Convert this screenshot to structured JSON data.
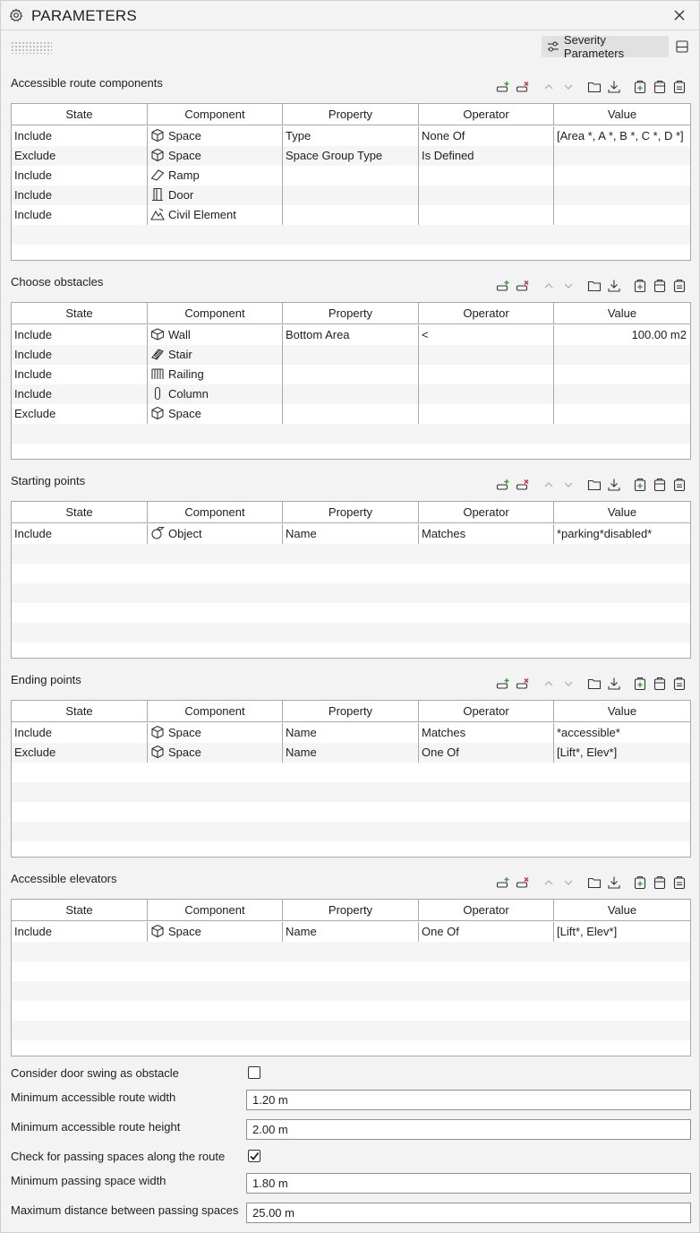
{
  "window": {
    "title": "PARAMETERS"
  },
  "toolbar": {
    "severity_label": "Severity Parameters"
  },
  "columns": [
    "State",
    "Component",
    "Property",
    "Operator",
    "Value"
  ],
  "sections": [
    {
      "title": "Accessible route components",
      "rows": [
        {
          "state": "Include",
          "icon": "space-icon",
          "component": "Space",
          "property": "Type",
          "operator": "None Of",
          "value": "[Area *, A *, B *, C *, D *]"
        },
        {
          "state": "Exclude",
          "icon": "space-icon",
          "component": "Space",
          "property": "Space Group Type",
          "operator": "Is Defined",
          "value": ""
        },
        {
          "state": "Include",
          "icon": "ramp-icon",
          "component": "Ramp",
          "property": "",
          "operator": "",
          "value": ""
        },
        {
          "state": "Include",
          "icon": "door-icon",
          "component": "Door",
          "property": "",
          "operator": "",
          "value": ""
        },
        {
          "state": "Include",
          "icon": "civil-element-icon",
          "component": "Civil Element",
          "property": "",
          "operator": "",
          "value": ""
        }
      ]
    },
    {
      "title": "Choose obstacles",
      "rows": [
        {
          "state": "Include",
          "icon": "wall-icon",
          "component": "Wall",
          "property": "Bottom Area",
          "operator": "<",
          "value": "100.00 m2"
        },
        {
          "state": "Include",
          "icon": "stair-icon",
          "component": "Stair",
          "property": "",
          "operator": "",
          "value": ""
        },
        {
          "state": "Include",
          "icon": "railing-icon",
          "component": "Railing",
          "property": "",
          "operator": "",
          "value": ""
        },
        {
          "state": "Include",
          "icon": "column-icon",
          "component": "Column",
          "property": "",
          "operator": "",
          "value": ""
        },
        {
          "state": "Exclude",
          "icon": "space-icon",
          "component": "Space",
          "property": "",
          "operator": "",
          "value": ""
        }
      ]
    },
    {
      "title": "Starting points",
      "rows": [
        {
          "state": "Include",
          "icon": "object-icon",
          "component": "Object",
          "property": "Name",
          "operator": "Matches",
          "value": "*parking*disabled*"
        }
      ]
    },
    {
      "title": "Ending points",
      "rows": [
        {
          "state": "Include",
          "icon": "space-icon",
          "component": "Space",
          "property": "Name",
          "operator": "Matches",
          "value": "*accessible*"
        },
        {
          "state": "Exclude",
          "icon": "space-icon",
          "component": "Space",
          "property": "Name",
          "operator": "One Of",
          "value": "[Lift*, Elev*]"
        }
      ]
    },
    {
      "title": "Accessible elevators",
      "rows": [
        {
          "state": "Include",
          "icon": "space-icon",
          "component": "Space",
          "property": "Name",
          "operator": "One Of",
          "value": "[Lift*, Elev*]"
        }
      ]
    }
  ],
  "form": {
    "door_swing_label": "Consider door swing as obstacle",
    "door_swing_checked": false,
    "min_width_label": "Minimum accessible route width",
    "min_width_value": "1.20 m",
    "min_height_label": "Minimum accessible route height",
    "min_height_value": "2.00 m",
    "passing_check_label": "Check for passing spaces along the route",
    "passing_check_checked": true,
    "min_passing_width_label": "Minimum passing space width",
    "min_passing_width_value": "1.80 m",
    "max_distance_label": "Maximum distance between passing spaces",
    "max_distance_value": "25.00 m"
  },
  "colors": {
    "add_green": "#3a9a3a",
    "remove_red": "#d03030",
    "text": "#1e1e1e",
    "border": "#a9a9a9"
  }
}
